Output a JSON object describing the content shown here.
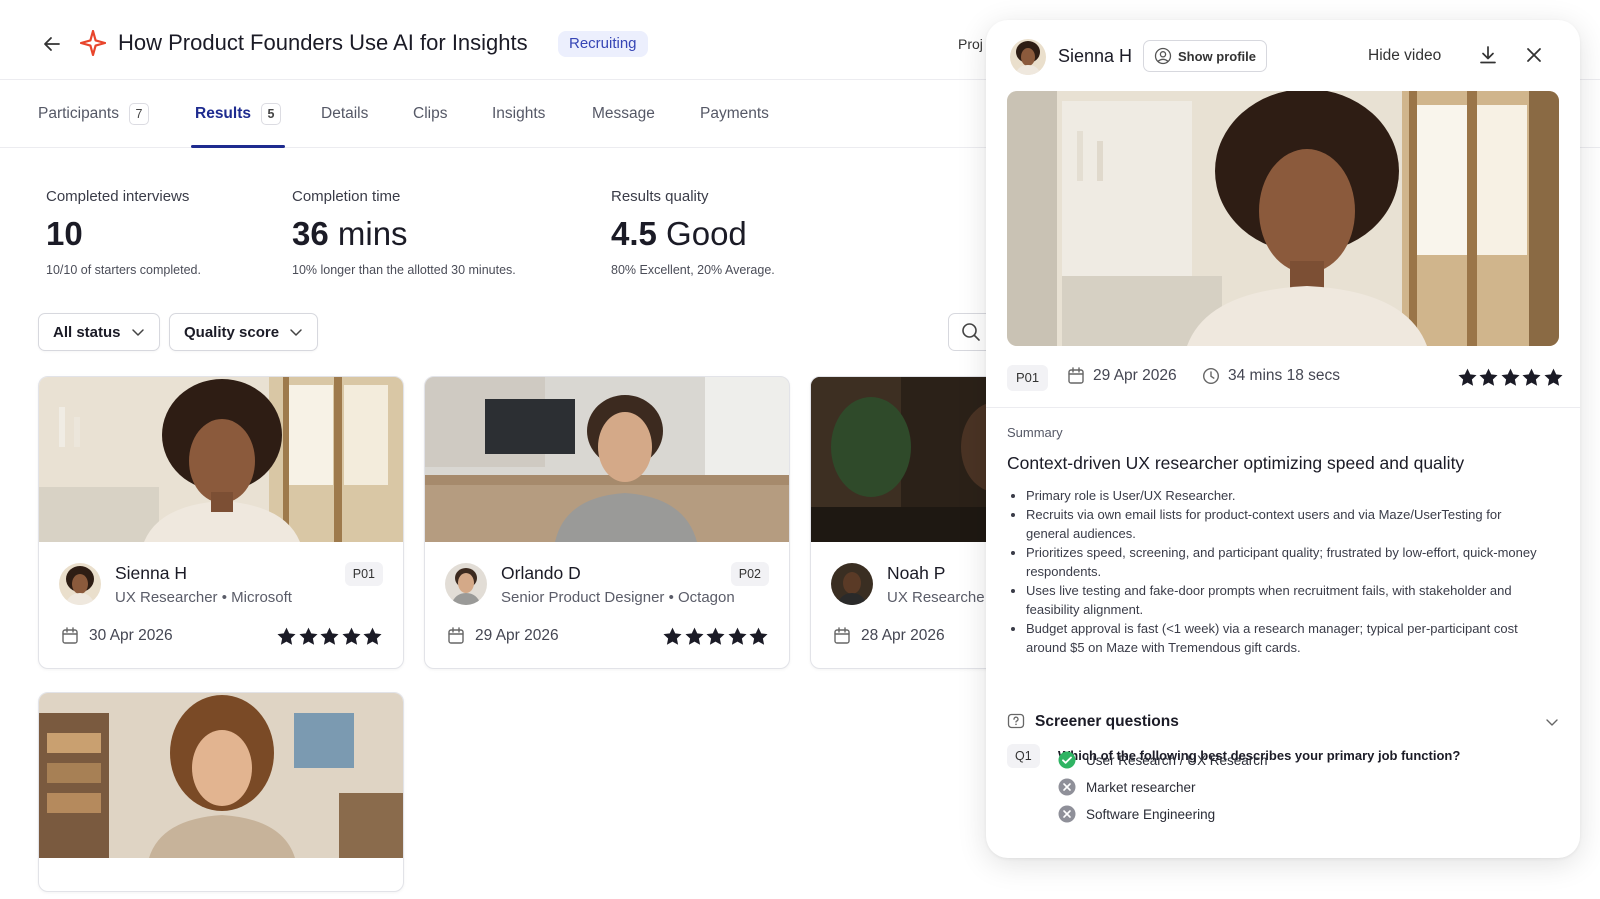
{
  "header": {
    "title": "How Product Founders Use AI for Insights",
    "status": "Recruiting",
    "project_label": "Proj"
  },
  "tabs": [
    {
      "label": "Participants",
      "count": "7"
    },
    {
      "label": "Results",
      "count": "5"
    },
    {
      "label": "Details"
    },
    {
      "label": "Clips"
    },
    {
      "label": "Insights"
    },
    {
      "label": "Message"
    },
    {
      "label": "Payments"
    }
  ],
  "stats": [
    {
      "label": "Completed interviews",
      "value_strong": "10",
      "value_rest": "",
      "sub": "10/10 of starters completed."
    },
    {
      "label": "Completion time",
      "value_strong": "36",
      "value_rest": " mins",
      "sub": "10% longer than the allotted 30 minutes."
    },
    {
      "label": "Results quality",
      "value_strong": "4.5",
      "value_rest": " Good",
      "sub": "80% Excellent, 20% Average."
    }
  ],
  "filters": {
    "status": "All status",
    "quality": "Quality score"
  },
  "cards": [
    {
      "name": "Sienna H",
      "role": "UX Researcher • Microsoft",
      "code": "P01",
      "date": "30 Apr 2026",
      "rating": 5
    },
    {
      "name": "Orlando D",
      "role": "Senior Product Designer • Octagon",
      "code": "P02",
      "date": "29 Apr 2026",
      "rating": 5
    },
    {
      "name": "Noah P",
      "role": "UX Researche",
      "date": "28 Apr 2026"
    }
  ],
  "panel": {
    "name": "Sienna H",
    "show_profile": "Show profile",
    "hide_video": "Hide video",
    "code": "P01",
    "date": "29 Apr 2026",
    "duration": "34 mins 18 secs",
    "rating": 5,
    "summary_label": "Summary",
    "summary_title": "Context-driven UX researcher optimizing speed and quality",
    "summary_points": [
      "Primary role is User/UX Researcher.",
      "Recruits via own email lists for product-context users and via Maze/UserTesting for general audiences.",
      "Prioritizes speed, screening, and participant quality; frustrated by low-effort, quick-money respondents.",
      "Uses live testing and fake-door prompts when recruitment fails, with stakeholder and feasibility alignment.",
      "Budget approval is fast (<1 week) via a research manager; typical per-participant cost around $5 on Maze with Tremendous gift cards."
    ],
    "screener_title": "Screener questions",
    "question_code": "Q1",
    "question": "Which of the following best describes your primary job function?",
    "options": [
      {
        "label": "User Research / UX Research",
        "selected": true
      },
      {
        "label": "Market researcher",
        "selected": false
      },
      {
        "label": "Software Engineering",
        "selected": false
      }
    ]
  },
  "colors": {
    "accent": "#1e2b8f",
    "logo": "#e8452c",
    "status_bg": "#eceffd",
    "selected": "#2fb463"
  }
}
